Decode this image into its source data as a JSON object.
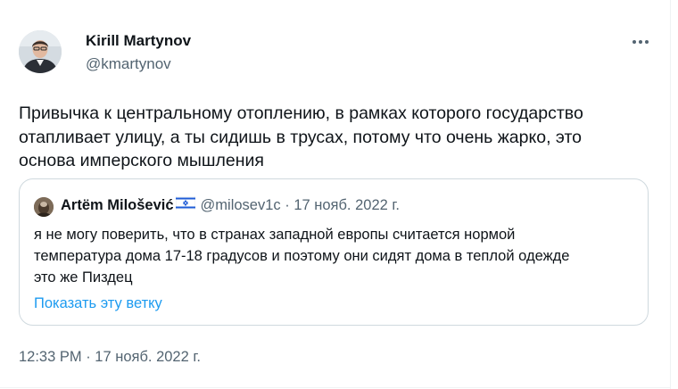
{
  "author": {
    "name": "Kirill Martynov",
    "handle": "@kmartynov"
  },
  "tweet": {
    "text": "Привычка к центральному отоплению, в рамках которого государство\nотапливает улицу, а ты сидишь в трусах, потому что очень жарко, это\nоснова имперского мышления",
    "timestamp": "12:33 PM · 17 нояб. 2022 г."
  },
  "quote": {
    "name": "Artëm Milošević",
    "flag_icon": "israel-flag-icon",
    "handle_date": "@milosev1c · 17 нояб. 2022 г.",
    "text": "я не могу поверить, что в странах западной европы считается нормой\nтемпература дома 17-18 градусов и поэтому они сидят дома в теплой одежде\nэто же Пиздец",
    "show_thread": "Показать эту ветку"
  },
  "more_icon": "more-horizontal-icon",
  "colors": {
    "text": "#0f1419",
    "secondary": "#536471",
    "link": "#1d9bf0",
    "border": "#cfd9de"
  }
}
